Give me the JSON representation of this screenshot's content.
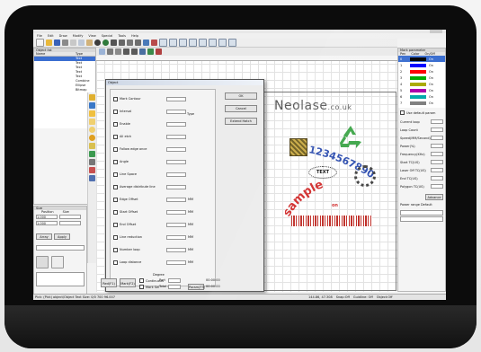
{
  "menu": [
    "File",
    "Edit",
    "Draw",
    "Modify",
    "View",
    "Special",
    "Tools",
    "Help"
  ],
  "object_list": {
    "header": "Object list",
    "columns": [
      "Name",
      "Type"
    ],
    "rows": [
      {
        "name": "",
        "type": "Text"
      },
      {
        "name": "",
        "type": "Text"
      },
      {
        "name": "",
        "type": "Text"
      },
      {
        "name": "",
        "type": "Text"
      },
      {
        "name": "",
        "type": "Text"
      },
      {
        "name": "",
        "type": "Combine"
      },
      {
        "name": "",
        "type": "Ellipse"
      },
      {
        "name": "",
        "type": "Bitmap"
      }
    ]
  },
  "dialog": {
    "title": "Object",
    "labels": [
      "Mark Contour",
      "Interval",
      "Enable",
      "All etch",
      "Follow edge once",
      "Angle",
      "Line Space",
      "Average distribute line",
      "Edge Offset",
      "Start Offset",
      "End Offset",
      "Line reduction",
      "Number loop",
      "Loop distance"
    ],
    "units": [
      "MM",
      "MM",
      "MM",
      "MM",
      "MM",
      "MM"
    ],
    "degree": "Degree",
    "ok": "OK",
    "cancel": "Cancel",
    "extend": "Extend Hatch",
    "type_label": "Type"
  },
  "canvas": {
    "logo_main": "Neolase",
    "logo_suffix": ".co.uk",
    "numbers": "1234567890",
    "text_label": "TEXT",
    "sample": "sample",
    "sample_sub": "on"
  },
  "position": {
    "header": "Size",
    "position_label": "Position",
    "size_label": "Size",
    "x_value": "1.000",
    "y_value": "1.000",
    "button_array": "Array",
    "button_apply": "Apply"
  },
  "mark_params": {
    "header": "Mark parameter",
    "columns": [
      "Pen",
      "Color",
      "On/Off"
    ],
    "pens": [
      {
        "name": "0",
        "color": "#000000",
        "on": "On"
      },
      {
        "name": "1",
        "color": "#0000ff",
        "on": "On"
      },
      {
        "name": "2",
        "color": "#ff0000",
        "on": "On"
      },
      {
        "name": "3",
        "color": "#00aa00",
        "on": "On"
      },
      {
        "name": "4",
        "color": "#aaaa00",
        "on": "On"
      },
      {
        "name": "5",
        "color": "#aa00aa",
        "on": "On"
      },
      {
        "name": "6",
        "color": "#00aaaa",
        "on": "On"
      },
      {
        "name": "7",
        "color": "#808080",
        "on": "On"
      }
    ],
    "use_default": "Use default param",
    "params": [
      "Current loop",
      "Loop Count",
      "Speed(MM/Second)",
      "Power(%)",
      "Frequency(KHz)",
      "Start TC(US)",
      "Laser Off TC(US)",
      "End TC(US)",
      "Polygon TC(US)"
    ],
    "advance": "Advance",
    "power_range": "Power range Default"
  },
  "bottom": {
    "red_button": "Red(F1)",
    "mark_button": "Mark(F2)",
    "continuous": "Continuous",
    "part_label": "Part",
    "mark_sel": "Mark Sel",
    "total_label": "Total #",
    "time1": "00:00:00",
    "time2": "00:00:00",
    "param_button": "Param(F3)"
  },
  "statusbar": {
    "left": "Pick: (Pick) object/Object Text Size: 0/0 700 96.007",
    "right": "144.86, 47.308",
    "snap": "Snap:Off",
    "guides": "Guidline: Off",
    "object": "Object:Off"
  }
}
